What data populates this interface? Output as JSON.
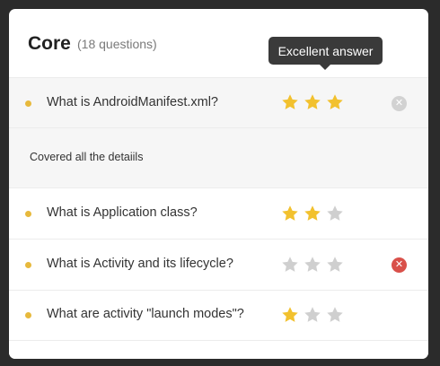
{
  "section": {
    "title": "Core",
    "count_label": "(18 questions)"
  },
  "tooltip": "Excellent answer",
  "colors": {
    "star_filled": "#f2c12e",
    "star_empty": "#cfcfcf",
    "bullet": "#e7b93c",
    "remove_active": "#d9504a",
    "remove_inactive": "#d2d2d2"
  },
  "questions": [
    {
      "text": "What is AndroidManifest.xml?",
      "rating": 3,
      "remove": "grey"
    },
    {
      "text": "What is Application class?",
      "rating": 2,
      "remove": "none"
    },
    {
      "text": "What is Activity and its lifecycle?",
      "rating": 0,
      "remove": "red"
    },
    {
      "text": "What are activity \"launch modes\"?",
      "rating": 1,
      "remove": "none"
    }
  ],
  "comment": "Covered all the detaiils"
}
